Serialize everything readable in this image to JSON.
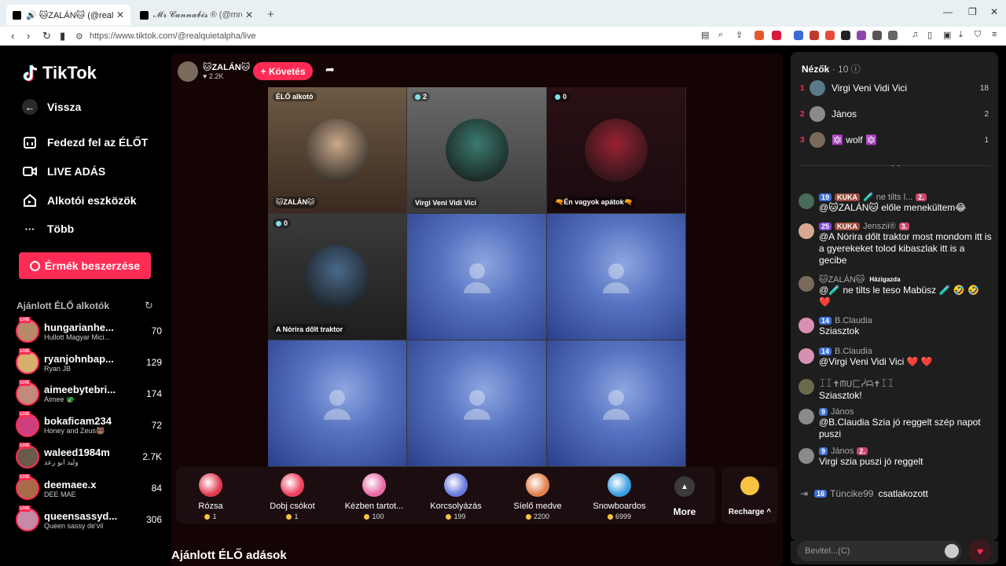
{
  "browser": {
    "tabs": [
      {
        "label": "🔊 🐱ZALÁN🐱 (@realquietalpha"
      },
      {
        "label": "𝓜𝓻 𝓒𝓪𝓷𝓷𝓪𝓫𝓲𝓼 ® (@mrcannabis_"
      }
    ],
    "url": "https://www.tiktok.com/@realquietalpha/live"
  },
  "sidebar": {
    "logo": "TikTok",
    "nav": [
      {
        "label": "Vissza"
      },
      {
        "label": "Fedezd fel az ÉLŐT"
      },
      {
        "label": "LIVE ADÁS"
      },
      {
        "label": "Alkotói eszközök"
      },
      {
        "label": "Több"
      }
    ],
    "coins_button": "Érmék beszerzése",
    "recommended_title": "Ajánlott ÉLŐ alkotók",
    "live_tag": "LIVE",
    "creators": [
      {
        "name": "hungarianhe...",
        "sub": "Hullott Magyar Mici...",
        "count": "70",
        "color": "#b88a6a"
      },
      {
        "name": "ryanjohnbap...",
        "sub": "Ryan JB",
        "count": "129",
        "color": "#d7b070"
      },
      {
        "name": "aimeebytebri...",
        "sub": "Aimee 🐲",
        "count": "174",
        "color": "#c28a7a"
      },
      {
        "name": "bokaficam234",
        "sub": "Honey and Zeus🐻",
        "count": "72",
        "color": "#cf3f7f"
      },
      {
        "name": "waleed1984m",
        "sub": "وليد ابو رعد",
        "count": "2.7K",
        "color": "#6a5a4a"
      },
      {
        "name": "deemaee.x",
        "sub": "DEE MAE",
        "count": "84",
        "color": "#a86c4a"
      },
      {
        "name": "queensassyd...",
        "sub": "Queen sassy de'vil",
        "count": "306",
        "color": "#c48aa8"
      }
    ]
  },
  "stage": {
    "host_name": "🐱ZALÁN🐱",
    "host_likes": "♥ 2.2K",
    "follow": "+ Követés",
    "cells": [
      {
        "badge": "ÉLŐ alkotó",
        "name": "🐱ZALÁN🐱",
        "bg": "linear-gradient(180deg,#6e5a44,#3a2a20)",
        "pic": "#c9a98a"
      },
      {
        "badge": "2",
        "name": "Virgi Veni Vidi Vici",
        "bg": "linear-gradient(180deg,#6a6a6a,#3a3a3a)",
        "pic": "#3b7a6e"
      },
      {
        "badge": "0",
        "name": "🔫Én vagyok apátok🔫",
        "bg": "linear-gradient(180deg,#2a1015,#1a0a0e)",
        "pic": "#992233"
      },
      {
        "badge": "0",
        "name": "A Nórira dőlt traktor",
        "bg": "linear-gradient(180deg,#3a3a3a,#1e1e1e)",
        "pic": "#4a6a8a"
      }
    ],
    "gifts": [
      {
        "name": "Rózsa",
        "price": "1",
        "color": "#e23a4e"
      },
      {
        "name": "Dobj csókot",
        "price": "1",
        "color": "#f0405e"
      },
      {
        "name": "Kézben tartot...",
        "price": "100",
        "color": "#e86aa8"
      },
      {
        "name": "Korcsolyázás",
        "price": "199",
        "color": "#6a7ae0"
      },
      {
        "name": "Síelő medve",
        "price": "2200",
        "color": "#e0804a"
      },
      {
        "name": "Snowboardos",
        "price": "6999",
        "color": "#3aa0e0"
      }
    ],
    "more": "More",
    "recharge": "Recharge ^",
    "recommended_live": "Ajánlott ÉLŐ adások"
  },
  "panel": {
    "viewers_label": "Nézők",
    "viewers_count": "· 10",
    "viewers": [
      {
        "rank": "1",
        "name": "Virgi Veni Vidi Vici",
        "score": "18",
        "color": "#5a7a8a"
      },
      {
        "rank": "2",
        "name": "János",
        "score": "2",
        "color": "#8a8a8a"
      },
      {
        "rank": "3",
        "name": "🔯 wolf 🔯",
        "score": "1",
        "color": "#7a6a5a"
      }
    ],
    "messages": [
      {
        "levels": [
          [
            "19",
            "blue"
          ],
          [
            "KUKA",
            "brown"
          ]
        ],
        "user": "🧪 ne tilts l...",
        "extra": "2.",
        "text": "@🐱ZALÁN🐱 előle menekültem😂",
        "color": "#4a6a5a"
      },
      {
        "levels": [
          [
            "25",
            "purple"
          ],
          [
            "KUKA",
            "brown"
          ]
        ],
        "user": "Jenszii®",
        "extra": "3.",
        "text": "@A Nórira dőlt traktor most mondom itt is a gyerekeket tolod kibaszlak itt is a gecibe",
        "color": "#d8a890"
      },
      {
        "levels": [],
        "user": "🐱ZALÁN🐱",
        "extra": "Házigazda",
        "text": "@🧪 ne tilts le teso Mabüsz 🧪 🤣 🤣 ❤️",
        "color": "#7a6a5a"
      },
      {
        "levels": [
          [
            "14",
            "blue"
          ]
        ],
        "user": "B.Claudia",
        "extra": "",
        "text": "Sziasztok",
        "color": "#d890b0"
      },
      {
        "levels": [
          [
            "14",
            "blue"
          ]
        ],
        "user": "B.Claudia",
        "extra": "",
        "text": "@Virgi Veni Vidi Vici ❤️ ❤️",
        "color": "#d890b0"
      },
      {
        "levels": [],
        "user": "ꀤꀤ✝ᗰᑌ匚ᓰᗩ✝ꀤꀤ",
        "extra": "",
        "text": "Sziasztok!",
        "color": "#6a6a4a"
      },
      {
        "levels": [
          [
            "9",
            "blue"
          ]
        ],
        "user": "János",
        "extra": "",
        "text": "@B.Claudia Szia jó reggelt szép napot puszi",
        "color": "#8a8a8a"
      },
      {
        "levels": [
          [
            "9",
            "blue"
          ]
        ],
        "user": "János",
        "extra": "2.",
        "text": "Virgi szia puszi jó reggelt",
        "color": "#8a8a8a"
      }
    ],
    "joined_level": "16",
    "joined_user": "Tüncike99",
    "joined_text": "csatlakozott",
    "input_placeholder": "Bevitel...(C)"
  }
}
